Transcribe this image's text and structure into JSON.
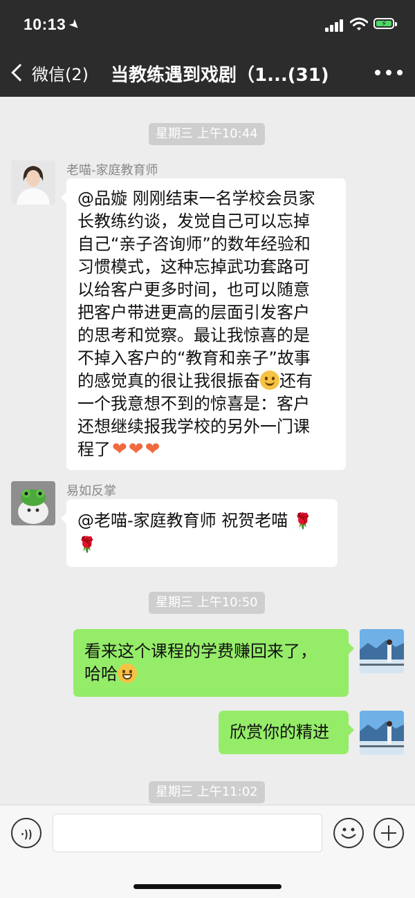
{
  "status_bar": {
    "time": "10:13",
    "location_icon": "location-arrow-icon",
    "battery_color": "#4cd964"
  },
  "nav": {
    "back_label": "微信(2)",
    "title": "当教练遇到戏剧（1...(31)",
    "more_icon": "more-dots-icon"
  },
  "messages": [
    {
      "type": "time",
      "text": "星期三 上午10:44"
    },
    {
      "type": "message",
      "side": "left",
      "sender": "老喵-家庭教育师",
      "lines": [
        "@品嫙 刚刚结束一名学校会员家",
        "长教练约谈，发觉自己可以忘掉",
        "自己“亲子咨询师”的数年经验和",
        "习惯模式，这种忘掉武功套路可",
        "以给客户更多时间，也可以随意",
        "把客户带进更高的层面引发客户",
        "的思考和觉察。最让我惊喜的是",
        "不掉入客户的“教育和亲子”故事",
        "的感觉真的很让我很振奋",
        "还有",
        "一个我意想不到的惊喜是：客户",
        "还想继续报我学校的另外一门课",
        "程了"
      ]
    },
    {
      "type": "message",
      "side": "left",
      "sender": "易如反掌",
      "text": "@老喵-家庭教育师 祝贺老喵"
    },
    {
      "type": "time",
      "text": "星期三 上午10:50"
    },
    {
      "type": "message",
      "side": "right",
      "lines": [
        "看来这个课程的学费赚回来了，",
        "哈哈"
      ]
    },
    {
      "type": "message",
      "side": "right",
      "text": "欣赏你的精进"
    },
    {
      "type": "time",
      "text": "星期三 上午11:02"
    }
  ],
  "input": {
    "value": ""
  },
  "colors": {
    "header_bg": "#2c2c2c",
    "chat_bg": "#ededed",
    "self_bubble": "#95ec69",
    "other_bubble": "#ffffff"
  }
}
